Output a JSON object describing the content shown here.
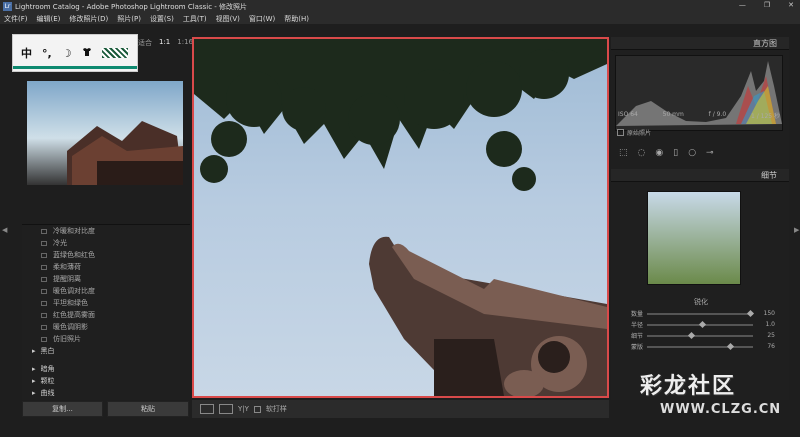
{
  "window": {
    "title": "Lightroom Catalog - Adobe Photoshop Lightroom Classic - 修改照片",
    "logo": "Lr",
    "minimize": "—",
    "maximize": "❐",
    "close": "✕"
  },
  "menu": [
    "文件(F)",
    "编辑(E)",
    "修改照片(D)",
    "照片(P)",
    "设置(S)",
    "工具(T)",
    "视图(V)",
    "窗口(W)",
    "帮助(H)"
  ],
  "ime": {
    "mode": "中",
    "punct": "°,",
    "moon": "☽",
    "shirt": "👕"
  },
  "navigator": {
    "fit": "适合",
    "zoom1": "1:1",
    "zoom2": "1:16"
  },
  "presets": {
    "items": [
      "冷暖和对比度",
      "冷光",
      "蓝绿色和红色",
      "柔和薄荷",
      "提醒阴离",
      "暖色调对比度",
      "平坦和绿色",
      "红色提高雾面",
      "暖色调阴影",
      "仿旧照片"
    ],
    "folder_bw": "黑白",
    "folder_more": [
      "暗角",
      "颗粒",
      "曲线"
    ]
  },
  "left_buttons": {
    "copy": "复制...",
    "paste": "粘贴"
  },
  "toolbar": {
    "yy": "Y|Y",
    "soft_proof": "软打样"
  },
  "histogram": {
    "header": "直方图",
    "iso": "ISO 64",
    "focal": "50 mm",
    "aperture": "f / 9.0",
    "shutter": "1 / 125 秒",
    "original": "原始照片"
  },
  "detail": {
    "header": "细节",
    "sharpen_label": "锐化",
    "sliders": [
      {
        "name": "数量",
        "value": "150",
        "pos": 0.95
      },
      {
        "name": "半径",
        "value": "1.0",
        "pos": 0.5
      },
      {
        "name": "细节",
        "value": "25",
        "pos": 0.4
      },
      {
        "name": "蒙版",
        "value": "76",
        "pos": 0.76
      }
    ]
  },
  "watermark": {
    "brand": "彩龙社区",
    "url": "WWW.CLZG.CN"
  }
}
